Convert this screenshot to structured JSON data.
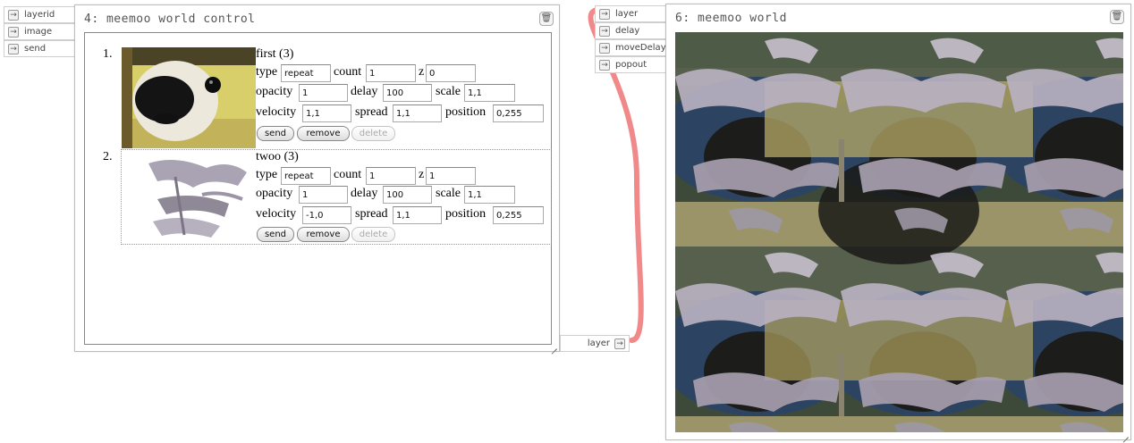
{
  "control_node": {
    "title": "4: meemoo world control",
    "inputs": [
      "layerid",
      "image",
      "send"
    ],
    "output": "layer",
    "layers": [
      {
        "index": "1.",
        "name": "first (3)",
        "type": "repeat",
        "count": "1",
        "z": "0",
        "opacity": "1",
        "delay": "100",
        "scale": "1,1",
        "velocity": "1,1",
        "spread": "1,1",
        "position": "0,255"
      },
      {
        "index": "2.",
        "name": "twoo (3)",
        "type": "repeat",
        "count": "1",
        "z": "1",
        "opacity": "1",
        "delay": "100",
        "scale": "1,1",
        "velocity": "-1,0",
        "spread": "1,1",
        "position": "0,255"
      }
    ],
    "field_labels": {
      "type": "type",
      "count": "count",
      "z": "z",
      "opacity": "opacity",
      "delay": "delay",
      "scale": "scale",
      "velocity": "velocity",
      "spread": "spread",
      "position": "position"
    },
    "buttons": {
      "send": "send",
      "remove": "remove",
      "delete": "delete"
    }
  },
  "world_node": {
    "title": "6: meemoo world",
    "inputs": [
      "layer",
      "delay",
      "moveDelay",
      "popout"
    ]
  },
  "icons": {
    "port_arrow": "arrow-right-icon",
    "trash": "trash-icon",
    "resize": "resize-grip-icon"
  },
  "colors": {
    "wire": "#f08a8a",
    "node_border": "#bdbdbd"
  }
}
